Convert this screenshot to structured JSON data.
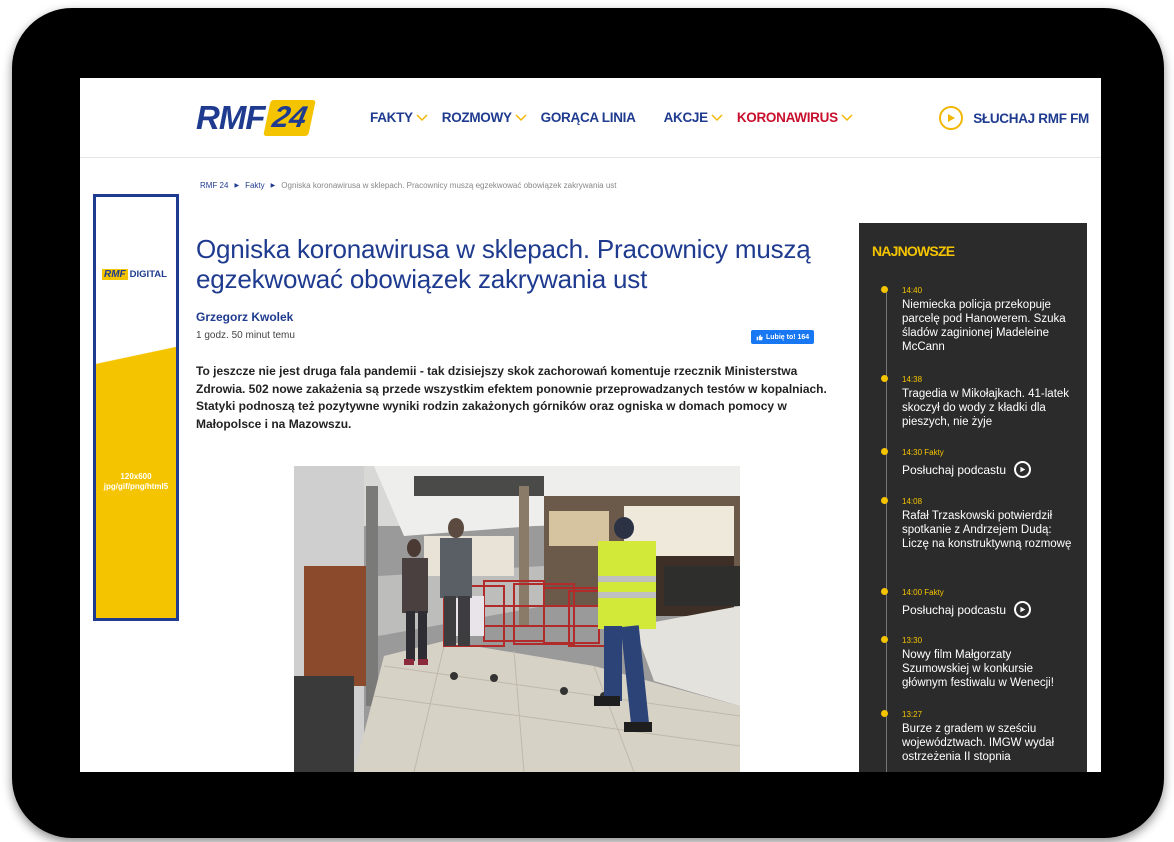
{
  "header": {
    "logo_text": "RMF",
    "logo_badge": "24",
    "nav": [
      {
        "label": "FAKTY",
        "has_dropdown": true,
        "color": "#1f3b8f"
      },
      {
        "label": "ROZMOWY",
        "has_dropdown": true,
        "color": "#1f3b8f"
      },
      {
        "label": "GORĄCA LINIA",
        "has_dropdown": false,
        "color": "#1f3b8f"
      },
      {
        "label": "AKCJE",
        "has_dropdown": true,
        "color": "#1f3b8f"
      },
      {
        "label": "KORONAWIRUS",
        "has_dropdown": true,
        "color": "#c8102e"
      }
    ],
    "listen_label": "SŁUCHAJ RMF FM"
  },
  "breadcrumb": {
    "items": [
      "RMF 24",
      "Fakty"
    ],
    "current": "Ogniska koronawirusa w sklepach. Pracownicy muszą egzekwować obowiązek zakrywania ust"
  },
  "ad": {
    "logo_mark": "RMF",
    "logo_label": "DIGITAL",
    "size_line1": "120x600",
    "size_line2": "jpg/gif/png/html5"
  },
  "article": {
    "title": "Ogniska koronawirusa w sklepach. Pracownicy muszą egzekwować obowiązek zakrywania ust",
    "author": "Grzegorz Kwolek",
    "time": "1 godz. 50 minut temu",
    "like_label": "Lubię to! 164",
    "lead": "To jeszcze nie jest druga fala pandemii - tak dzisiejszy skok zachorowań komentuje rzecznik Ministerstwa Zdrowia. 502 nowe zakażenia są przede wszystkim efektem ponownie przeprowadzanych testów w kopalniach. Statyki podnoszą też pozytywne wyniki rodzin zakażonych górników oraz ogniska w domach pomocy w Małopolsce i na Mazowszu."
  },
  "sidebar": {
    "title": "NAJNOWSZE",
    "items": [
      {
        "meta": "14:40",
        "text": "Niemiecka policja przekopuje parcelę pod Hanowerem. Szuka śladów zaginionej Madeleine McCann"
      },
      {
        "meta": "14:38",
        "text": "Tragedia w Mikołajkach. 41-latek skoczył do wody z kładki dla pieszych, nie żyje"
      },
      {
        "meta": "14:30 Fakty",
        "podcast": "Posłuchaj podcastu"
      },
      {
        "meta": "14:08",
        "text": "Rafał Trzaskowski potwierdził spotkanie z Andrzejem Dudą: Liczę na konstruktywną rozmowę"
      },
      {
        "meta": "14:00 Fakty",
        "podcast": "Posłuchaj podcastu"
      },
      {
        "meta": "13:30",
        "text": "Nowy film Małgorzaty Szumowskiej w konkursie głównym festiwalu w Wenecji!"
      },
      {
        "meta": "13:27",
        "text": "Burze z gradem w sześciu województwach. IMGW wydał ostrzeżenia II stopnia"
      }
    ]
  },
  "colors": {
    "brand_blue": "#1f3b8f",
    "brand_yellow": "#f5c400",
    "accent_red": "#c8102e",
    "sidebar_bg": "#2b2b2b"
  }
}
